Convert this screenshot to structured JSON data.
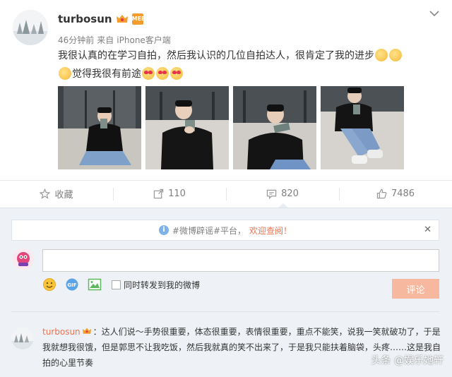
{
  "post": {
    "username": "turbosun",
    "member_badge": "MEB",
    "time": "46分钟前",
    "source_prefix": "来自",
    "source": "iPhone客户端",
    "text_line1": "我很认真的在学习自拍，然后我认识的几位自拍达人，很肯定了我的进步",
    "text_line2": "觉得我很有前途",
    "photo_count": 4
  },
  "actions": {
    "favorite": "收藏",
    "repost_count": "110",
    "comment_count": "820",
    "like_count": "7486"
  },
  "notice": {
    "text": "#微博辟谣#平台，",
    "link": "欢迎查阅！"
  },
  "composer": {
    "input_value": "",
    "repost_label": "同时转发到我的微博",
    "submit_label": "评论"
  },
  "comment": {
    "author": "turbosun",
    "text": "：达人们说～手势很重要，体态很重要，表情很重要，重点不能笑，说我一笑就破功了，于是我就想我很饿，但是郭思不让我吃饭，然后我就真的笑不出来了，于是我只能扶着脑袋，头疼……这是我自拍的心里节奏"
  },
  "watermark": "头条 @娱乐她轩",
  "icons": {
    "menu": "chevron-down-icon",
    "favorite": "star-icon",
    "repost": "repost-icon",
    "comment": "comment-icon",
    "like": "thumbs-up-icon",
    "info": "info-icon",
    "close": "close-icon",
    "emoji": "smiley-icon",
    "gif": "gif-icon",
    "image": "image-icon"
  },
  "colors": {
    "accent": "#eb7350",
    "submit_disabled": "#f7b8a0",
    "comment_bg": "#eef2f6"
  }
}
